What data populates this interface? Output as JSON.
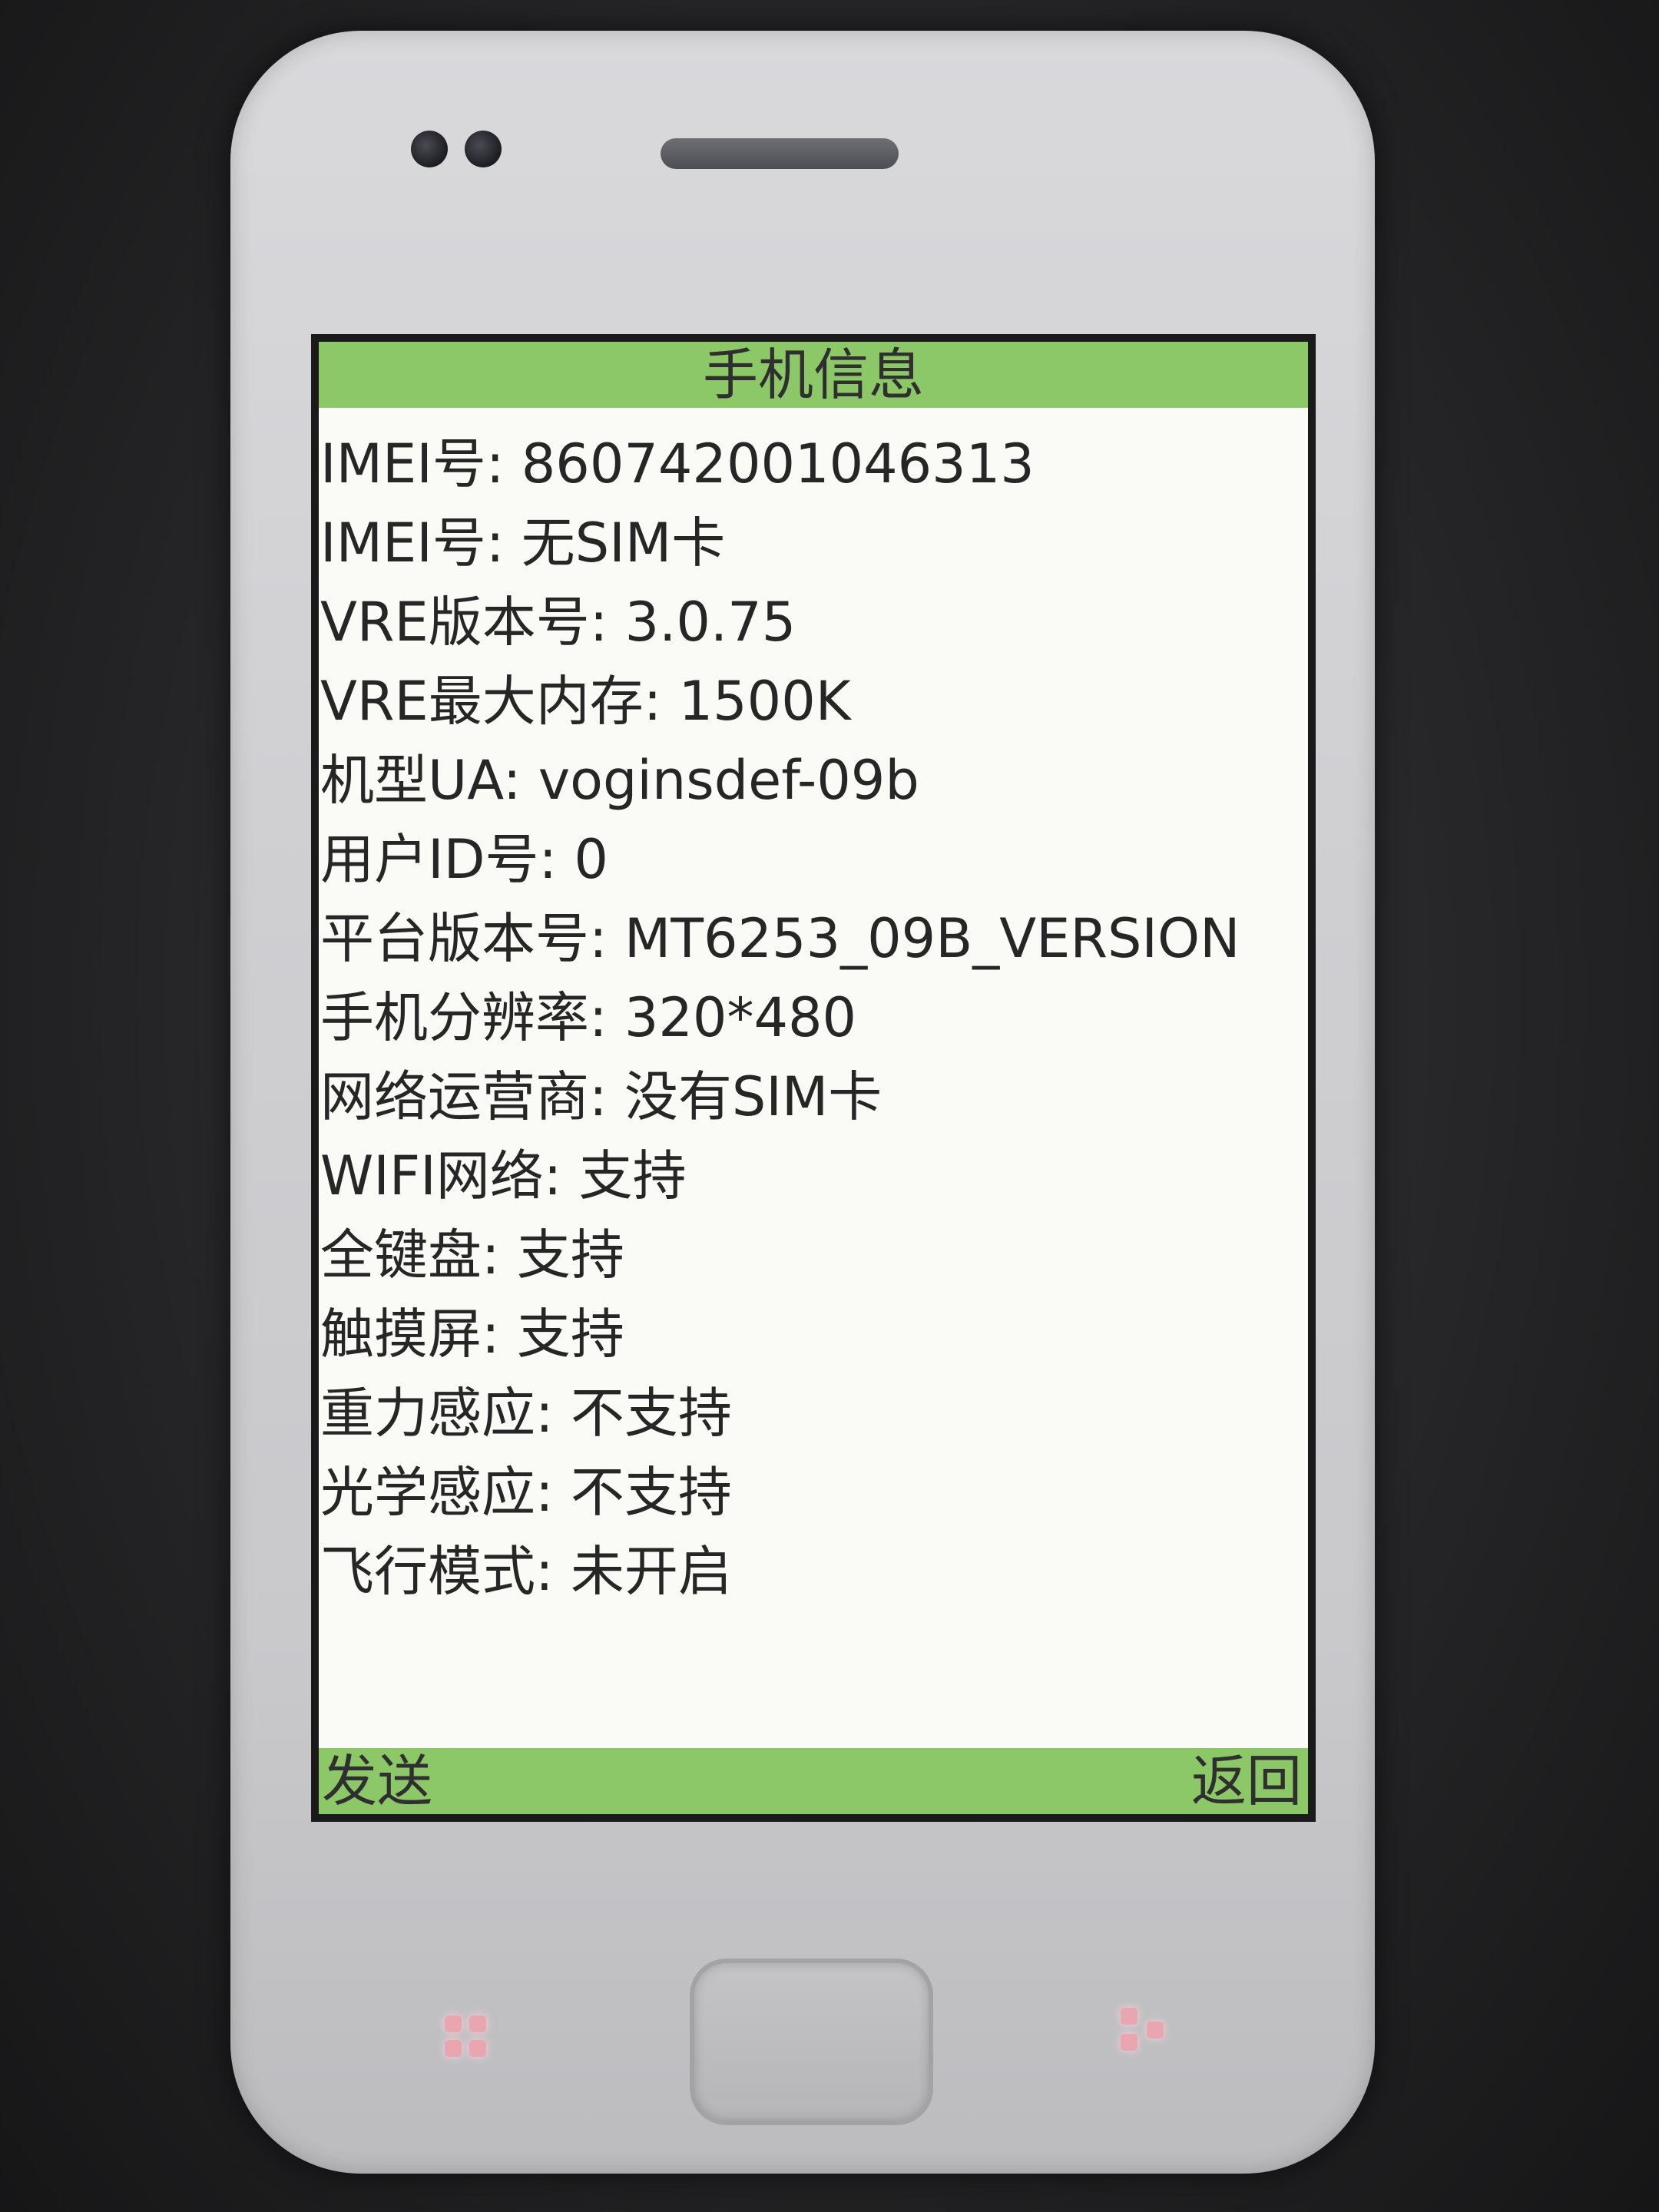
{
  "screen": {
    "title": "手机信息",
    "info": [
      "IMEI号: 860742001046313",
      "IMEI号: 无SIM卡",
      "VRE版本号: 3.0.75",
      "VRE最大内存: 1500K",
      "机型UA: voginsdef-09b",
      "用户ID号: 0",
      "平台版本号: MT6253_09B_VERSION",
      "手机分辨率: 320*480",
      "网络运营商: 没有SIM卡",
      "WIFI网络: 支持",
      "全键盘: 支持",
      "触摸屏: 支持",
      "重力感应: 不支持",
      "光学感应: 不支持",
      "飞行模式: 未开启"
    ],
    "softkeys": {
      "left": "发送",
      "right": "返回"
    }
  },
  "colors": {
    "bar_green": "#8cc868",
    "screen_bg": "#fafaf6",
    "text": "#262626",
    "key_glow": "#e8a6b0"
  },
  "icons": {
    "menu_key": "menu-key-icon",
    "back_key": "back-key-icon"
  }
}
